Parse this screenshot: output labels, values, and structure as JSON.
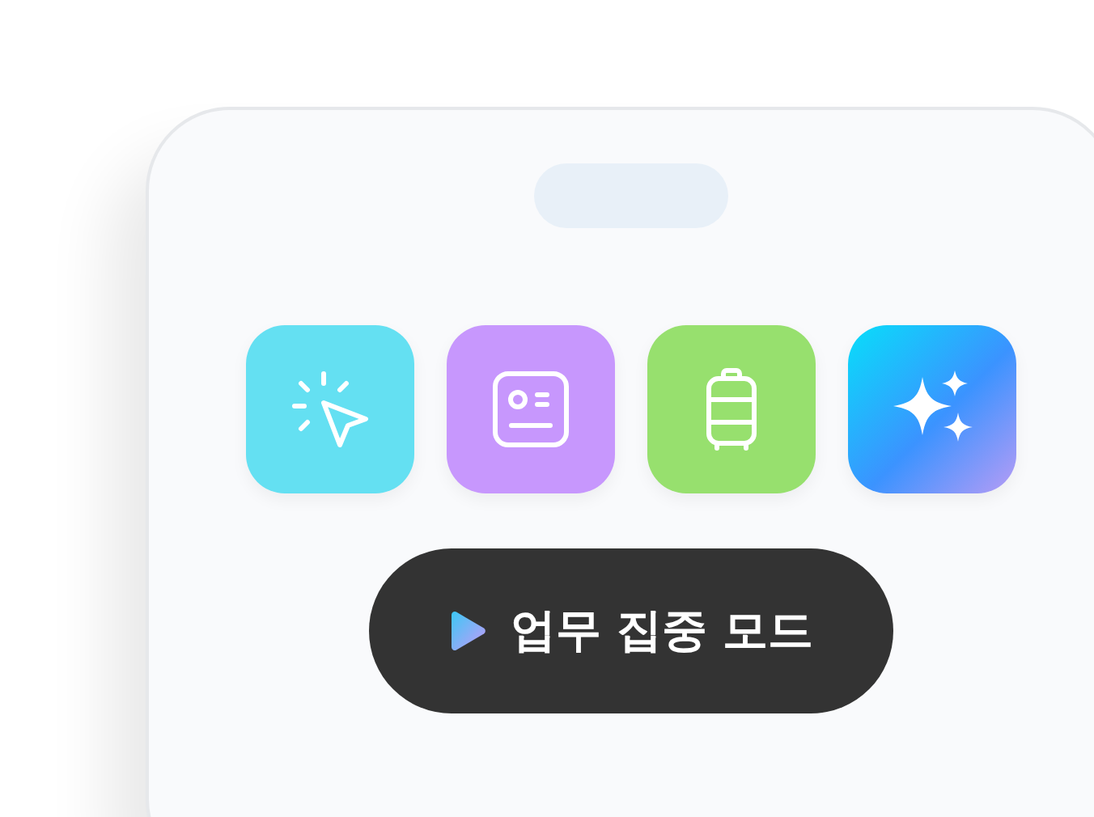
{
  "apps": [
    {
      "kind": "cursor"
    },
    {
      "kind": "id-card"
    },
    {
      "kind": "suitcase"
    },
    {
      "kind": "sparkle"
    }
  ],
  "focus_button": {
    "label": "업무 집중 모드"
  }
}
